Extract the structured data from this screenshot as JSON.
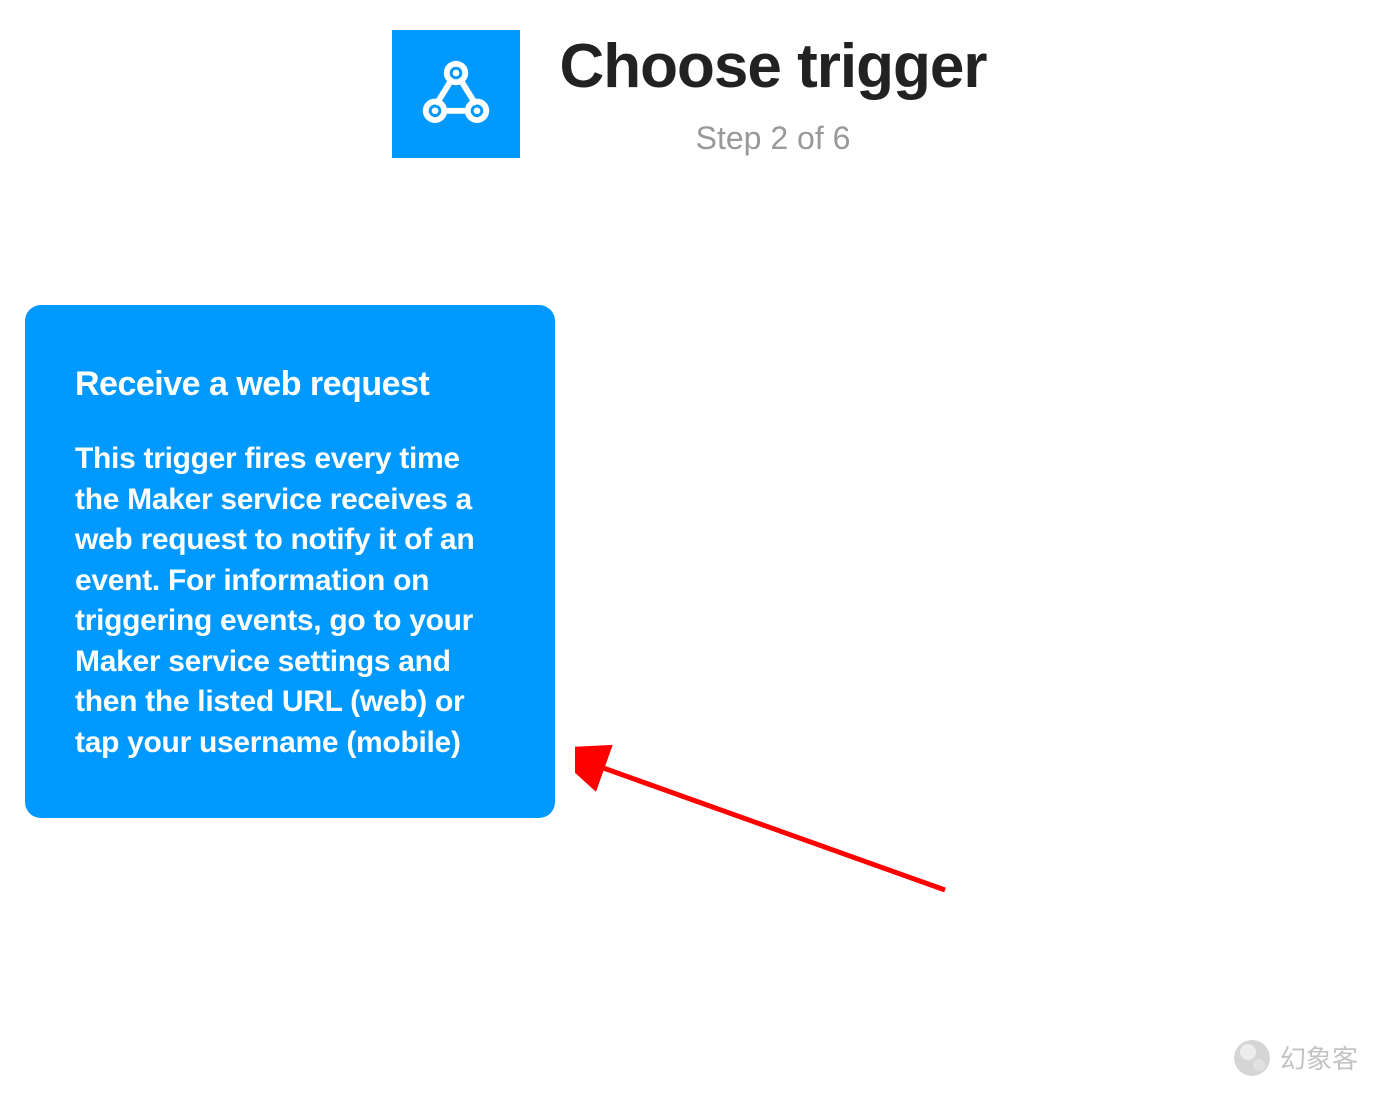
{
  "header": {
    "title": "Choose trigger",
    "step_label": "Step 2 of 6",
    "icon": "webhook-icon"
  },
  "trigger_card": {
    "title": "Receive a web request",
    "description": "This trigger fires every time the Maker service receives a web request to notify it of an event. For information on triggering events, go to your Maker service settings and then the listed URL (web) or tap your username (mobile)"
  },
  "watermark": {
    "text": "幻象客"
  },
  "colors": {
    "accent": "#0099ff",
    "title": "#222222",
    "muted": "#999999"
  }
}
